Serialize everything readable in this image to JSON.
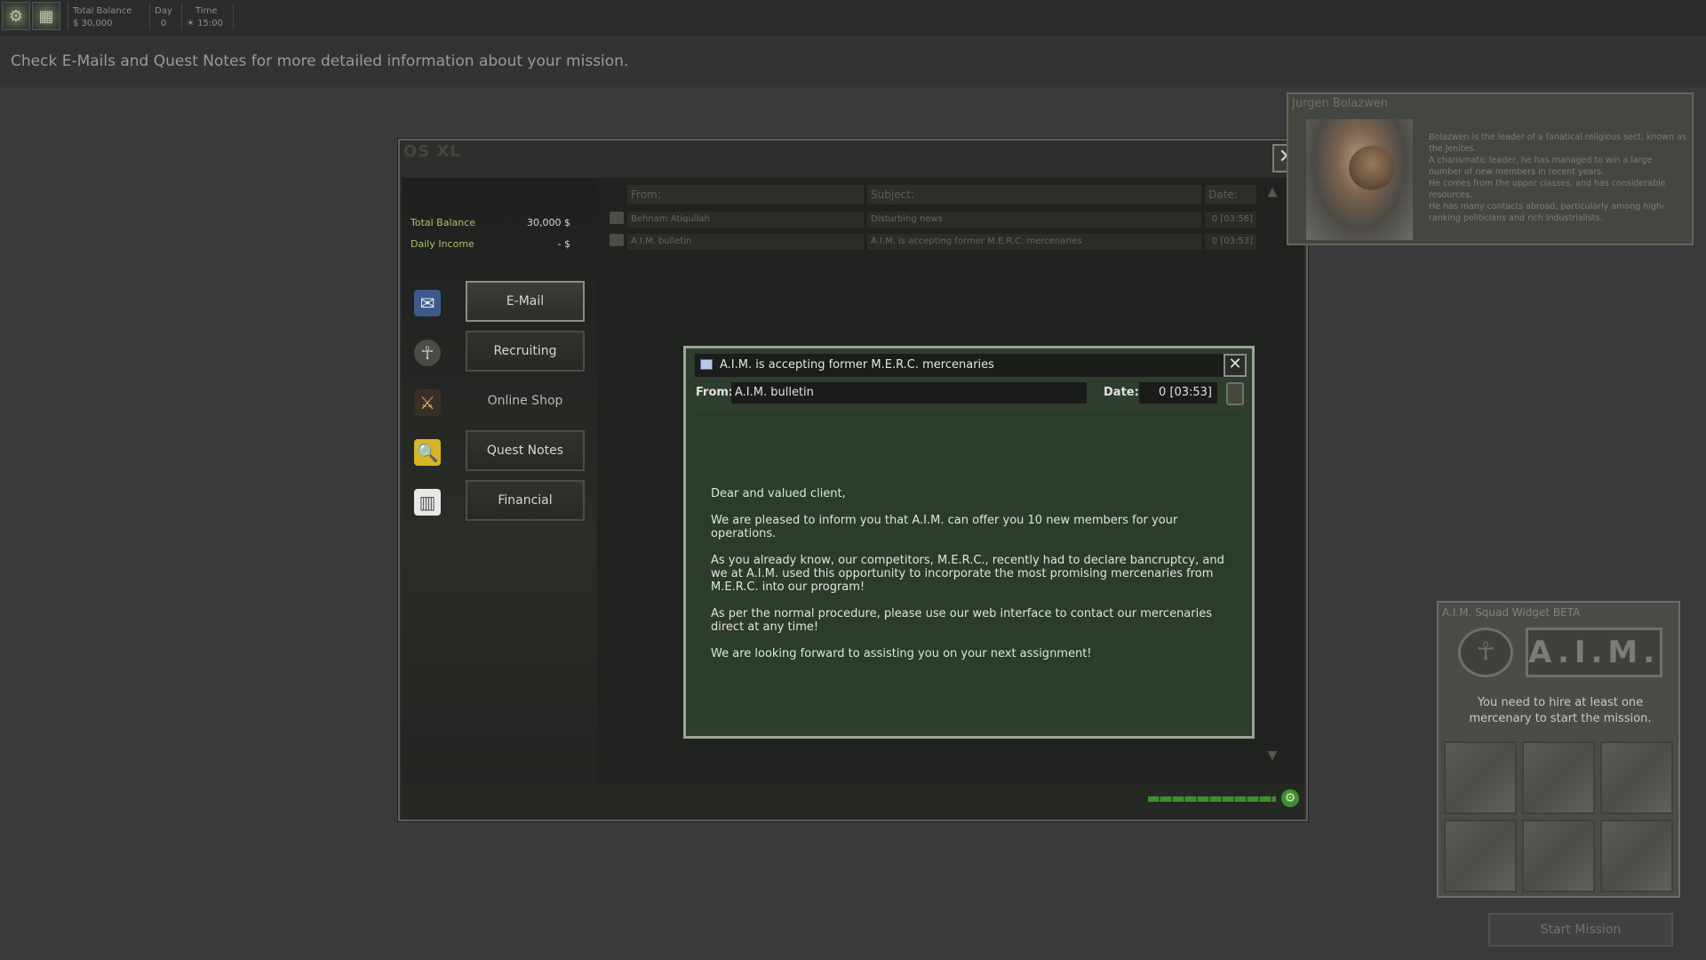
{
  "topbar": {
    "total_balance_label": "Total Balance",
    "total_balance_value": "$ 30,000",
    "day_label": "Day",
    "day_value": "0",
    "time_label": "Time",
    "time_value": "15:00"
  },
  "hint": "Check E-Mails and Quest Notes for more detailed information about your mission.",
  "laptop": {
    "title": "OS XL",
    "total_balance_label": "Total Balance",
    "total_balance_value": "30,000 $",
    "daily_income_label": "Daily Income",
    "daily_income_value": "- $",
    "menu": [
      {
        "label": "E-Mail",
        "icon": "mail-icon"
      },
      {
        "label": "Recruiting",
        "icon": "aim-icon"
      },
      {
        "label": "Online Shop",
        "icon": "shop-icon"
      },
      {
        "label": "Quest Notes",
        "icon": "folder-search-icon"
      },
      {
        "label": "Financial",
        "icon": "book-icon"
      }
    ],
    "email_list": {
      "headers": {
        "from": "From:",
        "subject": "Subject:",
        "date": "Date:"
      },
      "rows": [
        {
          "from": "Behnam Atiqullah",
          "subject": "Disturbing news",
          "date": "0 [03:56]"
        },
        {
          "from": "A.I.M. bulletin",
          "subject": "A.I.M. is accepting former M.E.R.C. mercenaries",
          "date": "0 [03:53]"
        }
      ]
    }
  },
  "message": {
    "title": "A.I.M. is accepting former M.E.R.C. mercenaries",
    "from_label": "From:",
    "from_value": "A.I.M. bulletin",
    "date_label": "Date:",
    "date_value": "0 [03:53]",
    "body": [
      "Dear and valued client,",
      "We are pleased to inform you that A.I.M. can offer you 10 new members for your operations.",
      "As you already know, our competitors, M.E.R.C., recently had to declare bancruptcy, and we at A.I.M. used this opportunity to incorporate the most promising mercenaries from M.E.R.C. into our program!",
      "As per the normal procedure, please use our web interface to contact our mercenaries direct at any time!",
      "We are looking forward to assisting you on your next assignment!"
    ]
  },
  "portrait": {
    "name": "Jurgen Bolazwen",
    "bio": [
      "Bolazwen is the leader of a fanatical religious sect, known as the Jenites.",
      "A charismatic leader, he has managed to win a large number of new members in recent years.",
      "He comes from the upper classes, and has considerable resources.",
      "He has many contacts abroad, particularly among high-ranking politicians and rich industrialists."
    ]
  },
  "squad_widget": {
    "title": "A.I.M. Squad Widget BETA",
    "logo_text": "A.I.M.",
    "message": "You need to hire at least one mercenary to start the mission.",
    "start_button": "Start Mission"
  }
}
